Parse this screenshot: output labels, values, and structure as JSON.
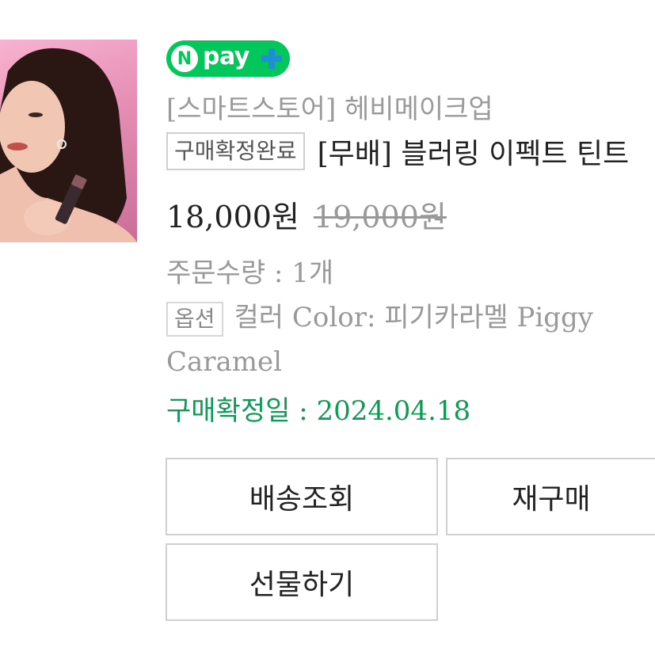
{
  "npay": {
    "letter": "N",
    "text": "pay"
  },
  "store": "[스마트스토어] 헤비메이크업",
  "status_badge": "구매확정완료",
  "product_title": "[무배] 블러링 이펙트 틴트",
  "price": {
    "current": "18,000원",
    "original": "19,000원"
  },
  "quantity": "주문수량 : 1개",
  "option": {
    "badge": "옵션",
    "text": "컬러 Color: 피기카라멜 Piggy Caramel"
  },
  "confirm_date": "구매확정일 : 2024.04.18",
  "buttons": {
    "track": "배송조회",
    "rebuy": "재구매",
    "gift": "선물하기"
  },
  "colors": {
    "npay_green": "#03c75a",
    "confirm_green": "#0f9a55"
  }
}
